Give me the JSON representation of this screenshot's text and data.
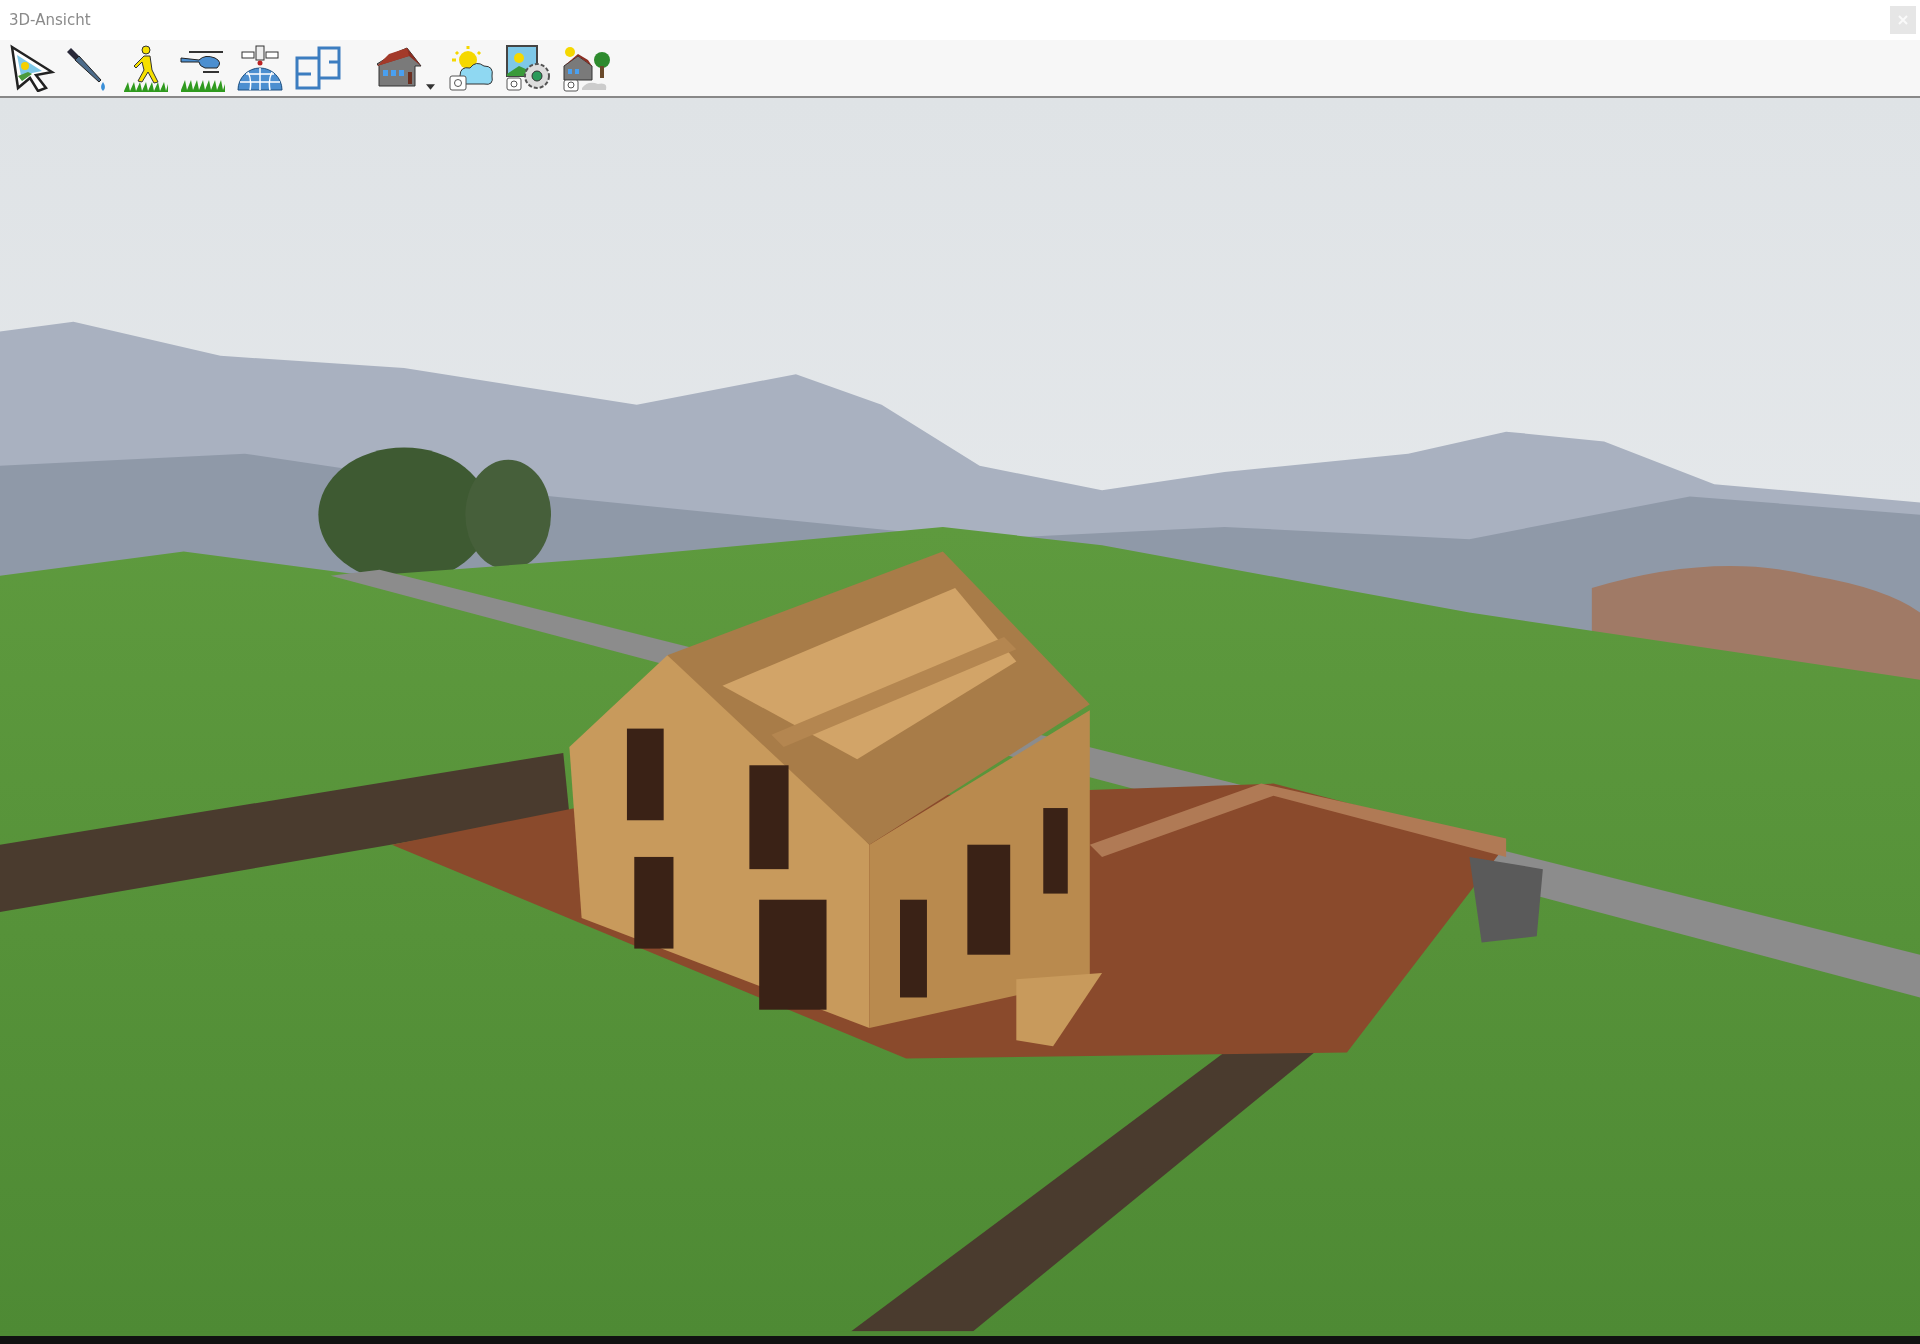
{
  "window": {
    "title": "3D-Ansicht"
  }
}
